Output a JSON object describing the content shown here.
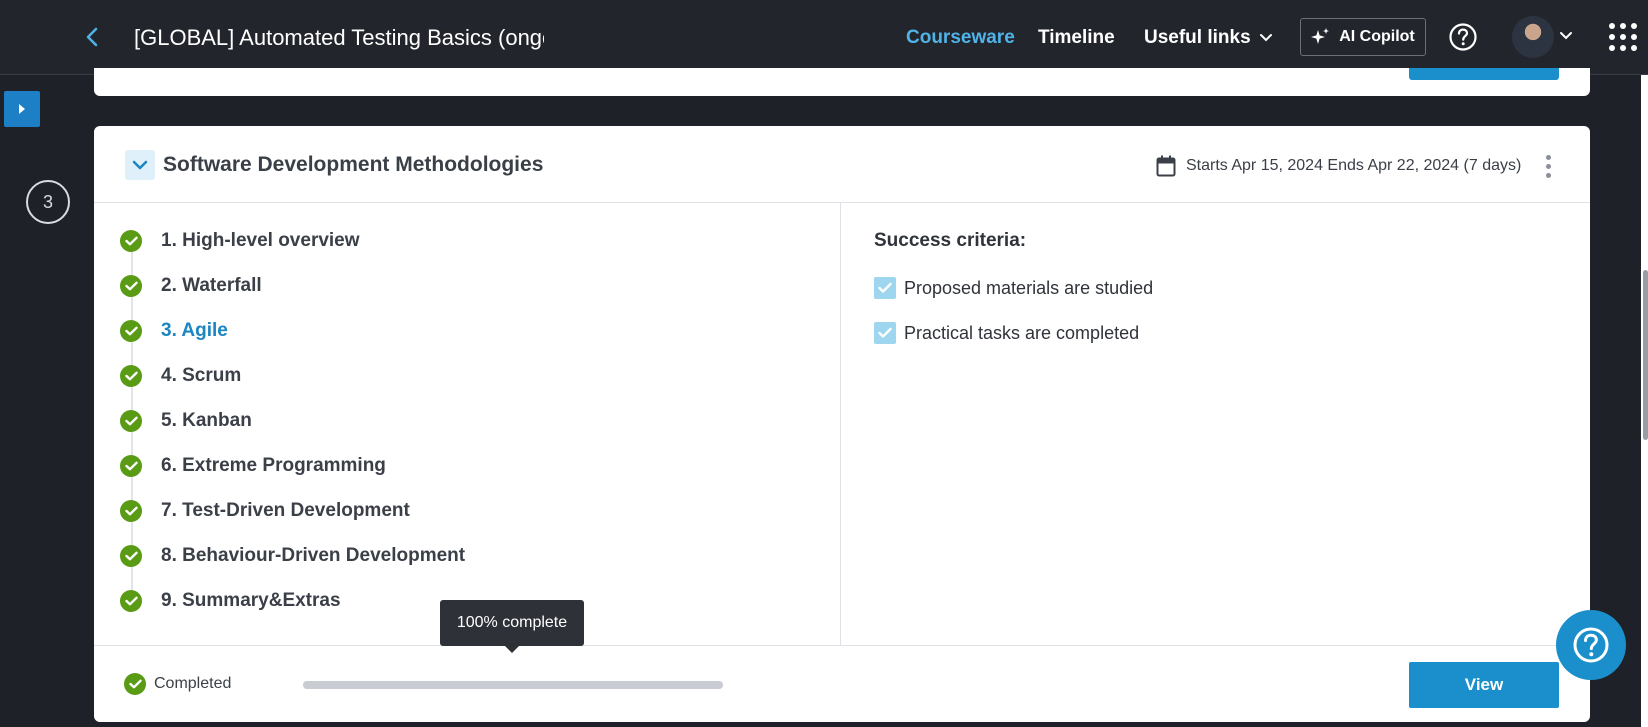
{
  "header": {
    "course_title": "[GLOBAL] Automated Testing Basics (ongoin",
    "tabs": [
      {
        "label": "Courseware",
        "active": true
      },
      {
        "label": "Timeline",
        "active": false
      }
    ],
    "useful_links_label": "Useful links",
    "copilot_label": "AI Copilot"
  },
  "rail": {
    "step_number": "3"
  },
  "section": {
    "title": "Software Development Methodologies",
    "date_range": "Starts Apr 15, 2024 Ends Apr 22, 2024 (7 days)",
    "lessons": [
      {
        "label": "1. High-level overview",
        "completed": true,
        "current": false
      },
      {
        "label": "2. Waterfall",
        "completed": true,
        "current": false
      },
      {
        "label": "3. Agile",
        "completed": true,
        "current": true
      },
      {
        "label": "4. Scrum",
        "completed": true,
        "current": false
      },
      {
        "label": "5. Kanban",
        "completed": true,
        "current": false
      },
      {
        "label": "6. Extreme Programming",
        "completed": true,
        "current": false
      },
      {
        "label": "7. Test-Driven Development",
        "completed": true,
        "current": false
      },
      {
        "label": "8. Behaviour-Driven Development",
        "completed": true,
        "current": false
      },
      {
        "label": "9. Summary&Extras",
        "completed": true,
        "current": false
      }
    ],
    "criteria_title": "Success criteria:",
    "criteria": [
      {
        "label": "Proposed materials are studied",
        "checked": true
      },
      {
        "label": "Practical tasks are completed",
        "checked": true
      }
    ],
    "status_label": "Completed",
    "progress_fraction": 1.0,
    "tooltip": "100% complete",
    "view_label": "View"
  },
  "colors": {
    "accent": "#1a8fcb",
    "active_tab": "#4fb3e8",
    "success": "#5a9b16",
    "topbar": "#23252c"
  }
}
